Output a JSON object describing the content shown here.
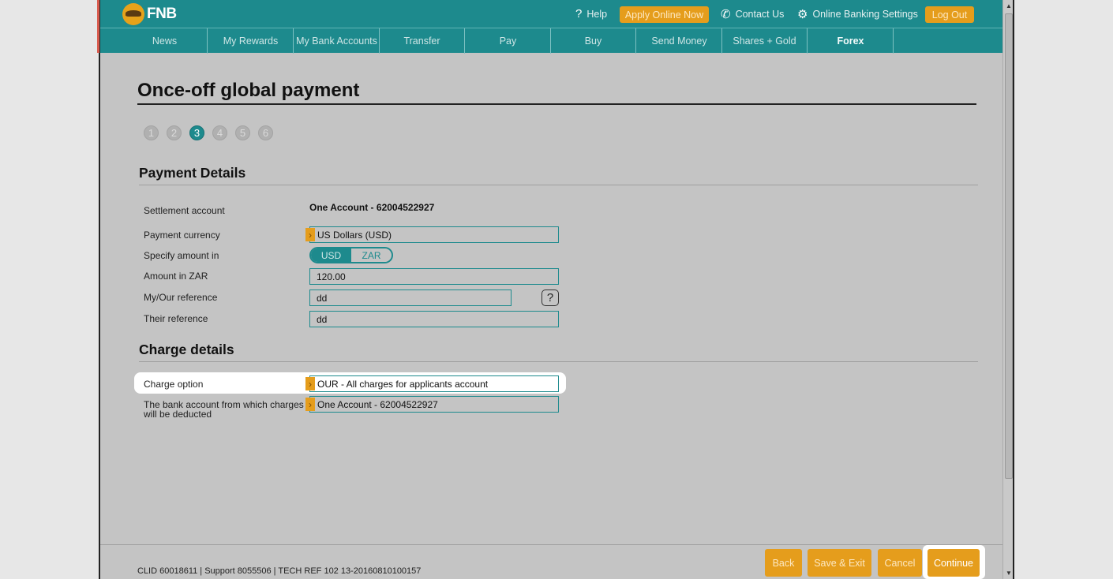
{
  "header": {
    "logo_text": "FNB",
    "help_label": "Help",
    "apply_label": "Apply Online Now",
    "contact_label": "Contact Us",
    "settings_label": "Online Banking Settings",
    "logout_label": "Log Out"
  },
  "nav": {
    "items": [
      {
        "label": "News"
      },
      {
        "label": "My Rewards"
      },
      {
        "label": "My Bank Accounts"
      },
      {
        "label": "Transfer"
      },
      {
        "label": "Pay"
      },
      {
        "label": "Buy"
      },
      {
        "label": "Send Money"
      },
      {
        "label": "Shares + Gold"
      },
      {
        "label": "Forex"
      }
    ]
  },
  "page": {
    "title": "Once-off global payment",
    "steps": [
      "1",
      "2",
      "3",
      "4",
      "5",
      "6"
    ],
    "active_step": "3"
  },
  "payment_details": {
    "heading": "Payment Details",
    "settlement_label": "Settlement account",
    "settlement_value": "One Account - 62004522927",
    "currency_label": "Payment currency",
    "currency_value": "US Dollars (USD)",
    "specify_label": "Specify amount in",
    "specify_options": [
      "USD",
      "ZAR"
    ],
    "specify_selected": "USD",
    "amount_label": "Amount in ZAR",
    "amount_value": "120.00",
    "my_ref_label": "My/Our reference",
    "my_ref_value": "dd",
    "their_ref_label": "Their reference",
    "their_ref_value": "dd"
  },
  "charge_details": {
    "heading": "Charge details",
    "option_label": "Charge option",
    "option_value": "OUR - All charges for applicants account",
    "account_label_1": "The bank account from which charges",
    "account_label_2": "will be deducted",
    "account_value": "One Account - 62004522927"
  },
  "footer": {
    "info": "CLID 60018611 | Support 8055506 | TECH REF 102 13-20160810100157",
    "back_label": "Back",
    "save_exit_label": "Save & Exit",
    "cancel_label": "Cancel",
    "continue_label": "Continue"
  },
  "colors": {
    "brand_teal": "#1d8a8d",
    "accent_orange": "#e59d1c"
  }
}
